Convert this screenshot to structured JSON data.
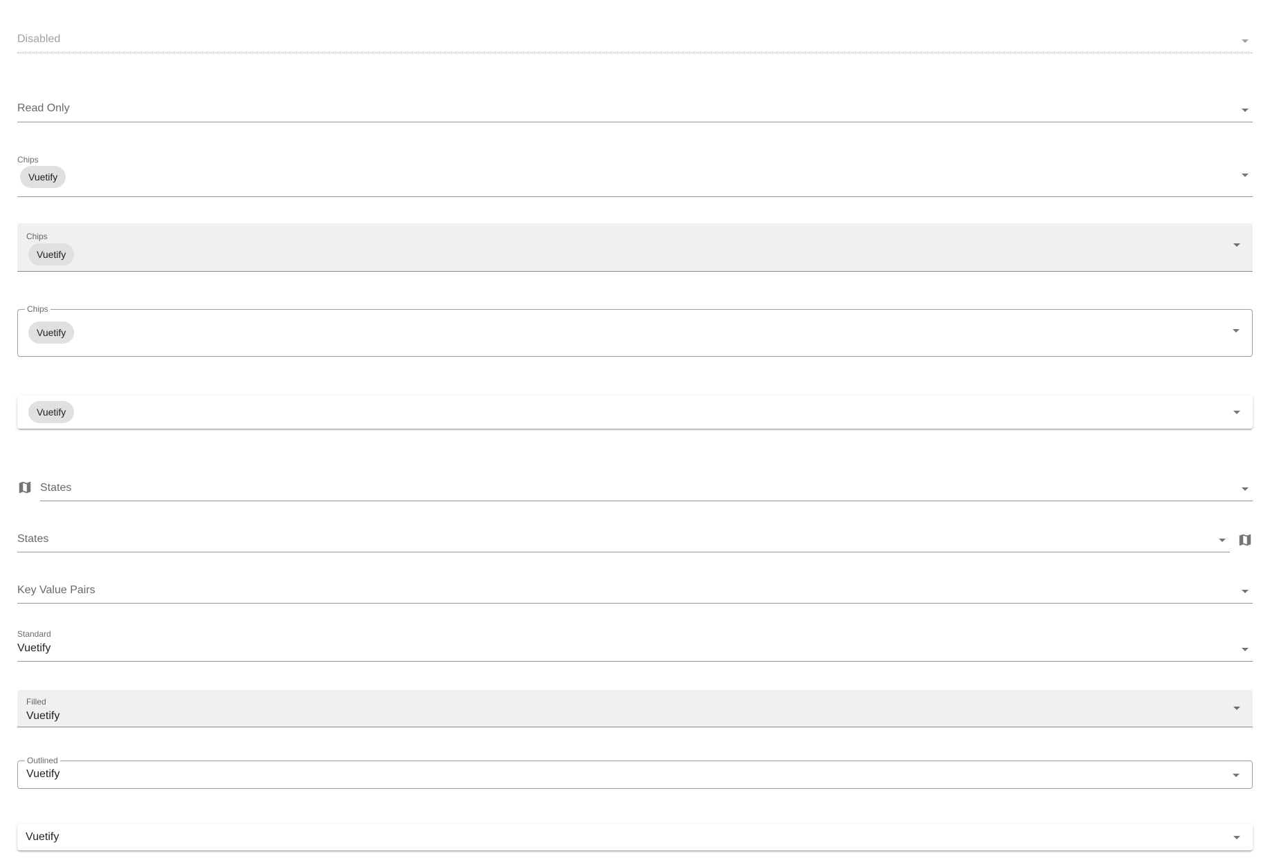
{
  "fields": {
    "disabled": {
      "label": "Disabled"
    },
    "read_only": {
      "label": "Read Only"
    },
    "chips_standard": {
      "label": "Chips",
      "chip": "Vuetify"
    },
    "chips_filled": {
      "label": "Chips",
      "chip": "Vuetify"
    },
    "chips_outlined": {
      "label": "Chips",
      "chip": "Vuetify"
    },
    "chips_solo": {
      "chip": "Vuetify"
    },
    "states_prepend": {
      "label": "States",
      "icon": "map-icon"
    },
    "states_append": {
      "label": "States",
      "icon": "map-icon"
    },
    "key_value": {
      "label": "Key Value Pairs"
    },
    "standard": {
      "label": "Standard",
      "value": "Vuetify"
    },
    "filled": {
      "label": "Filled",
      "value": "Vuetify"
    },
    "outlined": {
      "label": "Outlined",
      "value": "Vuetify"
    },
    "solo": {
      "value": "Vuetify"
    }
  },
  "icons": {
    "caret": "menu-down-icon",
    "map": "map-icon"
  },
  "colors": {
    "chip_bg": "#e0e0e0",
    "filled_bg": "#f0f0f0"
  }
}
